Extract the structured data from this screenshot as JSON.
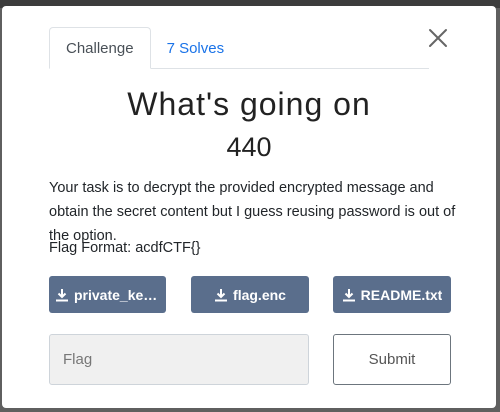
{
  "tabs": [
    {
      "label": "Challenge",
      "active": true
    },
    {
      "label": "7 Solves",
      "active": false
    }
  ],
  "challenge": {
    "name": "What's going on",
    "points": "440",
    "description": "Your task is to decrypt the provided encrypted message and obtain the secret content but I guess reusing password is out of the option.",
    "flag_format": "Flag Format: acdfCTF{}"
  },
  "files": [
    {
      "label": "private_key.p..."
    },
    {
      "label": "flag.enc"
    },
    {
      "label": "README.txt"
    }
  ],
  "form": {
    "flag_placeholder": "Flag",
    "submit_label": "Submit"
  },
  "colors": {
    "file_button": "#5a6e8c",
    "tab_link": "#1a73e8"
  },
  "icons": {
    "close": "close-icon",
    "download": "download-icon"
  }
}
